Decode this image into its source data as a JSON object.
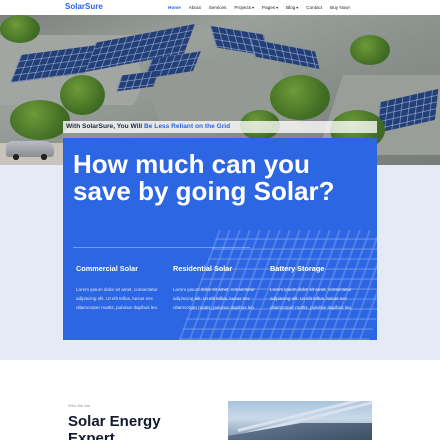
{
  "nav": {
    "logo": "SolarSure",
    "items": [
      {
        "label": "Home",
        "active": true,
        "dropdown": false
      },
      {
        "label": "About",
        "active": false,
        "dropdown": false
      },
      {
        "label": "Services",
        "active": false,
        "dropdown": false
      },
      {
        "label": "Projects",
        "active": false,
        "dropdown": true
      },
      {
        "label": "Pages",
        "active": false,
        "dropdown": true
      },
      {
        "label": "Blog",
        "active": false,
        "dropdown": true
      },
      {
        "label": "Contact",
        "active": false,
        "dropdown": false
      },
      {
        "label": "Buy Now!",
        "active": false,
        "dropdown": false
      }
    ]
  },
  "hero": {
    "tagline_prefix": "With SolarSure, You Will ",
    "tagline_highlight": "Be Less Reliant on the Grid",
    "title": "How much can you save by going Solar?",
    "features": [
      {
        "title": "Commercial Solar",
        "text": "Lorem ipsum dolor sit amet, consectetur adipiscing elit. Ut elit tellus, luctus nec ullamcorper mattis, pulvinar dapibus leo."
      },
      {
        "title": "Residential Solar",
        "text": "Lorem ipsum dolor sit amet, consectetur adipiscing elit. Ut elit tellus, luctus nec ullamcorper mattis, pulvinar dapibus leo."
      },
      {
        "title": "Battery Storage",
        "text": "Lorem ipsum dolor sit amet, consectetur adipiscing elit. Ut elit tellus, luctus nec ullamcorper mattis, pulvinar dapibus leo."
      }
    ]
  },
  "about": {
    "kicker": "Who We Are",
    "title": "Solar Energy Expert"
  },
  "colors": {
    "brand": "#2b64e6",
    "card": "#2c66e3",
    "band": "#e4ebf6",
    "text_dark": "#121a2a"
  }
}
